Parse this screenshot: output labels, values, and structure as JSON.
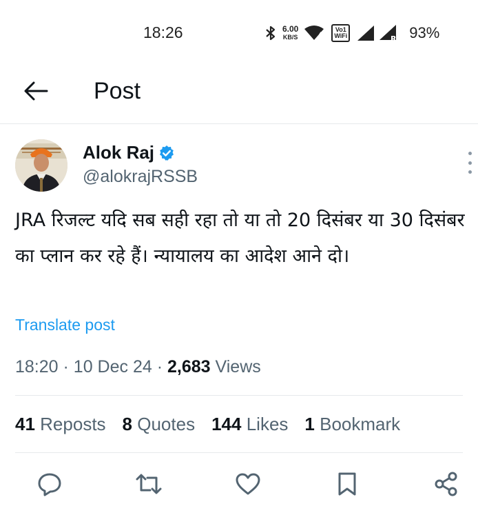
{
  "status_bar": {
    "time": "18:26",
    "net_speed_value": "6.00",
    "net_speed_unit": "KB/S",
    "vowifi_line1": "Vo",
    "vowifi_line2": "WiFi",
    "vowifi_sim": "1",
    "battery_percent": "93%",
    "icons": [
      "bluetooth-icon",
      "wifi-icon",
      "signal-icon",
      "signal-roaming-icon"
    ]
  },
  "header": {
    "title": "Post",
    "back_icon": "arrow-left-icon"
  },
  "author": {
    "name": "Alok Raj",
    "handle": "@alokrajRSSB",
    "verified": true,
    "verified_color": "#1d9bf0"
  },
  "post": {
    "text": "JRA रिजल्ट यदि सब सही रहा तो या तो 20 दिसंबर या 30 दिसंबर का प्लान कर रहे हैं। न्यायालय का आदेश आने दो।",
    "translate_label": "Translate post",
    "time": "18:20",
    "date": "10 Dec 24",
    "views_count": "2,683",
    "views_label": "Views"
  },
  "stats": {
    "reposts_count": "41",
    "reposts_label": "Reposts",
    "quotes_count": "8",
    "quotes_label": "Quotes",
    "likes_count": "144",
    "likes_label": "Likes",
    "bookmarks_count": "1",
    "bookmarks_label": "Bookmark"
  },
  "actions": [
    "reply-icon",
    "repost-icon",
    "like-icon",
    "bookmark-icon",
    "share-icon"
  ],
  "colors": {
    "accent": "#1d9bf0",
    "text_primary": "#0f1419",
    "text_secondary": "#536471"
  }
}
